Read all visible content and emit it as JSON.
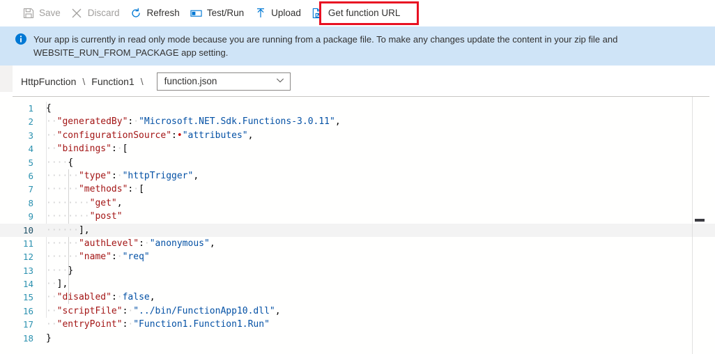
{
  "toolbar": {
    "items": [
      {
        "label": "Save",
        "icon": "save-icon",
        "enabled": false
      },
      {
        "label": "Discard",
        "icon": "discard-x-icon",
        "enabled": false
      },
      {
        "label": "Refresh",
        "icon": "refresh-icon",
        "enabled": true
      },
      {
        "label": "Test/Run",
        "icon": "test-run-icon",
        "enabled": true
      },
      {
        "label": "Upload",
        "icon": "upload-arrow-icon",
        "enabled": true
      },
      {
        "label": "Get function URL",
        "icon": "get-url-icon",
        "enabled": true
      }
    ],
    "highlight_color": "#e81123"
  },
  "banner": {
    "icon": "info-icon",
    "message": "Your app is currently in read only mode because you are running from a package file. To make any changes update the content in your zip file and WEBSITE_RUN_FROM_PACKAGE app setting.",
    "background_color": "#cfe4f7"
  },
  "breadcrumb": {
    "app_name": "HttpFunction",
    "separator_1": "\\",
    "function_name": "Function1",
    "separator_2": "\\",
    "file_select": {
      "value": "function.json",
      "chevron": "chevron-down-icon"
    }
  },
  "editor": {
    "active_line": 10,
    "colors": {
      "key": "#a31515",
      "string": "#0451a5",
      "punctuation": "#000000",
      "line_number": "#2b91af",
      "active_line_background": "#f3f3f3"
    },
    "lines": [
      {
        "n": "1",
        "tokens": [
          {
            "t": "{",
            "c": "p"
          }
        ]
      },
      {
        "n": "2",
        "tokens": [
          {
            "t": "··",
            "c": "ws"
          },
          {
            "t": "\"generatedBy\"",
            "c": "k"
          },
          {
            "t": ":",
            "c": "p"
          },
          {
            "t": "·",
            "c": "ws"
          },
          {
            "t": "\"Microsoft.NET.Sdk.Functions-3.0.11\"",
            "c": "s"
          },
          {
            "t": ",",
            "c": "p"
          }
        ]
      },
      {
        "n": "3",
        "tokens": [
          {
            "t": "··",
            "c": "ws"
          },
          {
            "t": "\"configurationSource\"",
            "c": "k"
          },
          {
            "t": ":",
            "c": "p"
          },
          {
            "t": "•",
            "c": "wsr"
          },
          {
            "t": "\"attributes\"",
            "c": "s"
          },
          {
            "t": ",",
            "c": "p"
          }
        ]
      },
      {
        "n": "4",
        "tokens": [
          {
            "t": "··",
            "c": "ws"
          },
          {
            "t": "\"bindings\"",
            "c": "k"
          },
          {
            "t": ":",
            "c": "p"
          },
          {
            "t": "·",
            "c": "ws"
          },
          {
            "t": "[",
            "c": "p"
          }
        ]
      },
      {
        "n": "5",
        "tokens": [
          {
            "t": "····",
            "c": "ws"
          },
          {
            "t": "{",
            "c": "p"
          }
        ]
      },
      {
        "n": "6",
        "tokens": [
          {
            "t": "······",
            "c": "ws"
          },
          {
            "t": "\"type\"",
            "c": "k"
          },
          {
            "t": ":",
            "c": "p"
          },
          {
            "t": "·",
            "c": "ws"
          },
          {
            "t": "\"httpTrigger\"",
            "c": "s"
          },
          {
            "t": ",",
            "c": "p"
          }
        ]
      },
      {
        "n": "7",
        "tokens": [
          {
            "t": "······",
            "c": "ws"
          },
          {
            "t": "\"methods\"",
            "c": "k"
          },
          {
            "t": ":",
            "c": "p"
          },
          {
            "t": "·",
            "c": "ws"
          },
          {
            "t": "[",
            "c": "p"
          }
        ]
      },
      {
        "n": "8",
        "tokens": [
          {
            "t": "········",
            "c": "ws"
          },
          {
            "t": "\"get\"",
            "c": "sv"
          },
          {
            "t": ",",
            "c": "p"
          }
        ]
      },
      {
        "n": "9",
        "tokens": [
          {
            "t": "········",
            "c": "ws"
          },
          {
            "t": "\"post\"",
            "c": "sv"
          }
        ]
      },
      {
        "n": "10",
        "tokens": [
          {
            "t": "······",
            "c": "ws"
          },
          {
            "t": "],",
            "c": "p"
          }
        ]
      },
      {
        "n": "11",
        "tokens": [
          {
            "t": "······",
            "c": "ws"
          },
          {
            "t": "\"authLevel\"",
            "c": "k"
          },
          {
            "t": ":",
            "c": "p"
          },
          {
            "t": "·",
            "c": "ws"
          },
          {
            "t": "\"anonymous\"",
            "c": "s"
          },
          {
            "t": ",",
            "c": "p"
          }
        ]
      },
      {
        "n": "12",
        "tokens": [
          {
            "t": "······",
            "c": "ws"
          },
          {
            "t": "\"name\"",
            "c": "k"
          },
          {
            "t": ":",
            "c": "p"
          },
          {
            "t": "·",
            "c": "ws"
          },
          {
            "t": "\"req\"",
            "c": "s"
          }
        ]
      },
      {
        "n": "13",
        "tokens": [
          {
            "t": "····",
            "c": "ws"
          },
          {
            "t": "}",
            "c": "p"
          }
        ]
      },
      {
        "n": "14",
        "tokens": [
          {
            "t": "··",
            "c": "ws"
          },
          {
            "t": "],",
            "c": "p"
          }
        ]
      },
      {
        "n": "15",
        "tokens": [
          {
            "t": "··",
            "c": "ws"
          },
          {
            "t": "\"disabled\"",
            "c": "k"
          },
          {
            "t": ":",
            "c": "p"
          },
          {
            "t": "·",
            "c": "ws"
          },
          {
            "t": "false",
            "c": "b"
          },
          {
            "t": ",",
            "c": "p"
          }
        ]
      },
      {
        "n": "16",
        "tokens": [
          {
            "t": "··",
            "c": "ws"
          },
          {
            "t": "\"scriptFile\"",
            "c": "k"
          },
          {
            "t": ":",
            "c": "p"
          },
          {
            "t": "·",
            "c": "ws"
          },
          {
            "t": "\"../bin/FunctionApp10.dll\"",
            "c": "s"
          },
          {
            "t": ",",
            "c": "p"
          }
        ]
      },
      {
        "n": "17",
        "tokens": [
          {
            "t": "··",
            "c": "ws"
          },
          {
            "t": "\"entryPoint\"",
            "c": "k"
          },
          {
            "t": ":",
            "c": "p"
          },
          {
            "t": "·",
            "c": "ws"
          },
          {
            "t": "\"Function1.Function1.Run\"",
            "c": "s"
          }
        ]
      },
      {
        "n": "18",
        "tokens": [
          {
            "t": "}",
            "c": "p"
          }
        ]
      }
    ]
  }
}
